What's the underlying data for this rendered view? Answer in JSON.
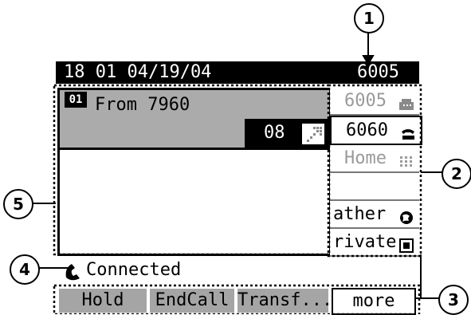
{
  "status_bar": {
    "datetime": "18 01 04/19/04",
    "extension": "6005"
  },
  "call": {
    "line_badge": "01",
    "from": "From 7960",
    "timer": "08"
  },
  "line_buttons": [
    {
      "label": "6005",
      "state": "active",
      "icon": "desk-phone-icon"
    },
    {
      "label": "6060",
      "state": "normal",
      "icon": "handset-icon"
    },
    {
      "label": "Home",
      "state": "dim",
      "icon": "keypad-icon"
    },
    {
      "label": "",
      "state": "empty",
      "icon": ""
    },
    {
      "label": "ather",
      "state": "normal",
      "icon": "globe-icon"
    },
    {
      "label": "rivate",
      "state": "normal",
      "icon": "square-icon"
    }
  ],
  "call_state": "Connected",
  "softkeys": [
    "Hold",
    "EndCall",
    "Transf...",
    "more"
  ],
  "callouts": [
    "1",
    "2",
    "3",
    "4",
    "5"
  ]
}
